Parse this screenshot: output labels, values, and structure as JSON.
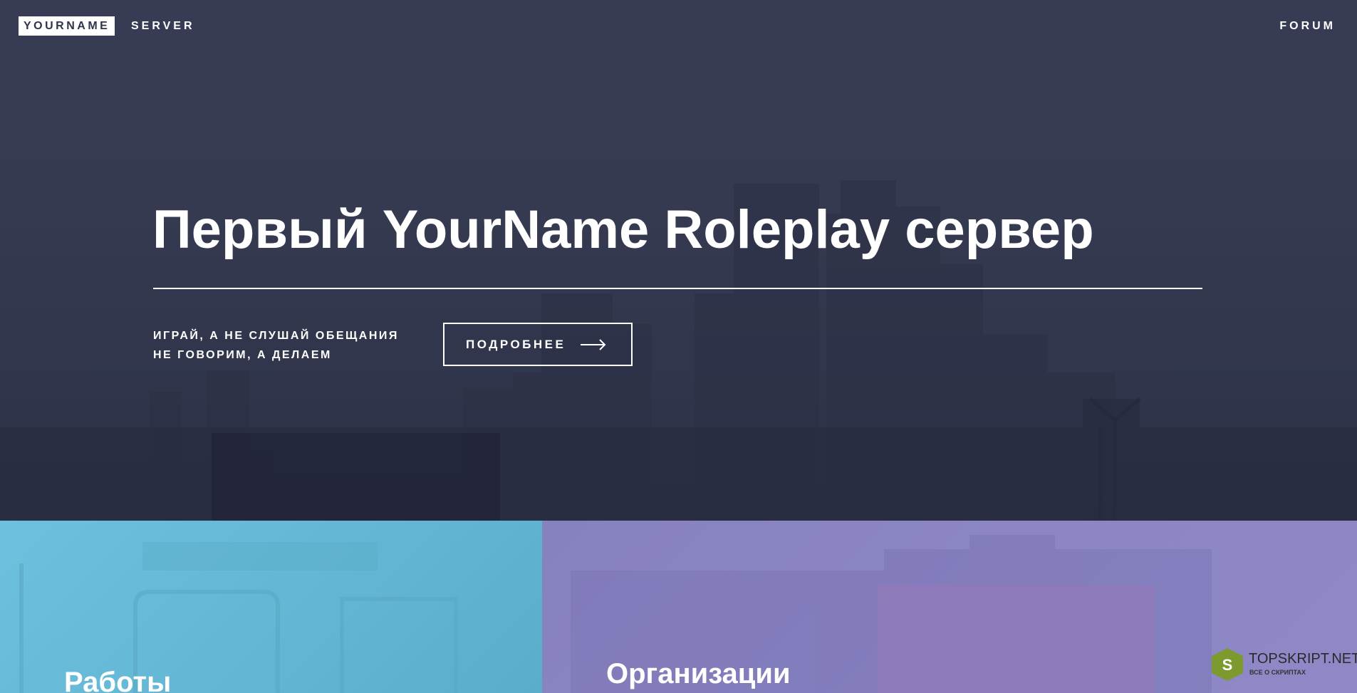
{
  "navbar": {
    "logo_name": "YOURNAME",
    "logo_suffix": "SERVER",
    "forum_link": "FORUM"
  },
  "hero": {
    "title": "Первый YourName Roleplay сервер",
    "tagline_line1": "ИГРАЙ, А НЕ СЛУШАЙ ОБЕЩАНИЯ",
    "tagline_line2": "НЕ ГОВОРИМ, А ДЕЛАЕМ",
    "more_button_label": "ПОДРОБНЕЕ"
  },
  "panels": [
    {
      "title": "Работы",
      "color": "#6dc1de"
    },
    {
      "title": "Организации",
      "color": "#8681bf"
    }
  ],
  "watermark": {
    "badge_letter": "S",
    "site": "TOPSKRIPT.NET",
    "subtitle": "ВСЕ О СКРИПТАХ"
  },
  "colors": {
    "hero_bg": "#363a52",
    "text": "#ffffff",
    "watermark_badge": "#7d9a2f"
  }
}
